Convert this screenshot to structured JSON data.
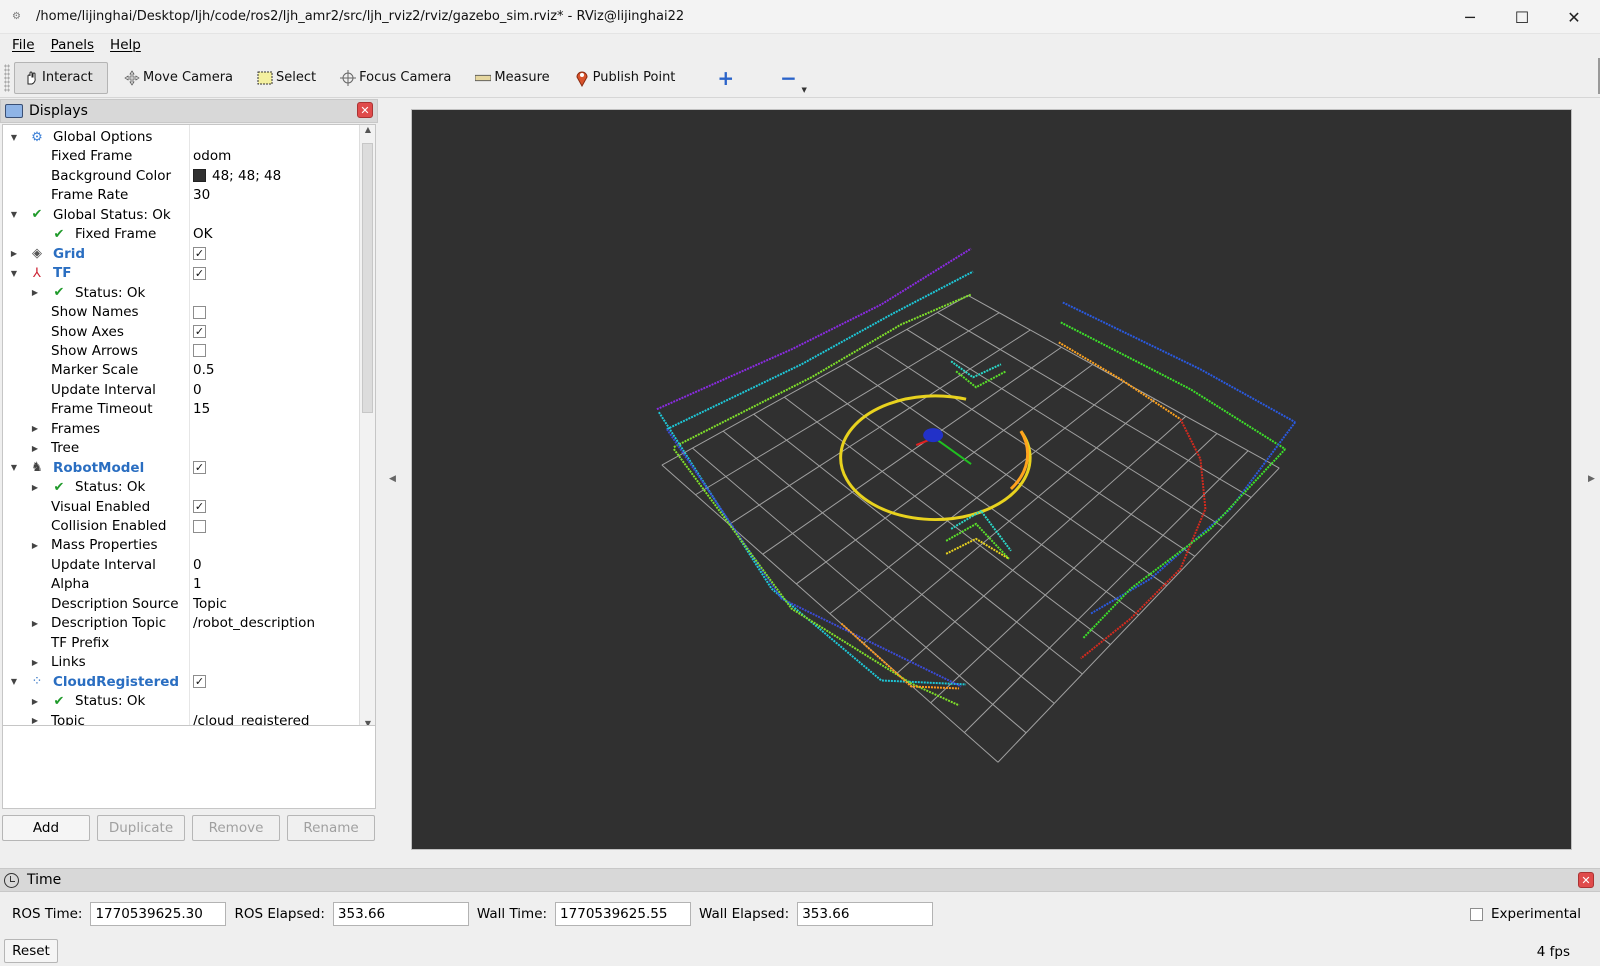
{
  "window": {
    "title": "/home/lijinghai/Desktop/ljh/code/ros2/ljh_amr2/src/ljh_rviz2/rviz/gazebo_sim.rviz* - RViz@lijinghai22",
    "controls": [
      "─",
      "☐",
      "✕"
    ]
  },
  "menu": [
    "File",
    "Panels",
    "Help"
  ],
  "toolbar": {
    "tools": [
      {
        "label": "Interact",
        "icon": "hand-icon",
        "active": true
      },
      {
        "label": "Move Camera",
        "icon": "move-camera-icon"
      },
      {
        "label": "Select",
        "icon": "select-icon"
      },
      {
        "label": "Focus Camera",
        "icon": "focus-camera-icon"
      },
      {
        "label": "Measure",
        "icon": "ruler-icon"
      },
      {
        "label": "Publish Point",
        "icon": "pin-icon"
      }
    ],
    "plus": "+",
    "minus": "−"
  },
  "displays": {
    "title": "Displays",
    "rows": [
      {
        "level": 0,
        "arrow": "▼",
        "icon": "gear",
        "label": "Global Options"
      },
      {
        "level": 1,
        "label": "Fixed Frame",
        "value": "odom"
      },
      {
        "level": 1,
        "label": "Background Color",
        "value": "48; 48; 48",
        "swatch": true
      },
      {
        "level": 1,
        "label": "Frame Rate",
        "value": "30"
      },
      {
        "level": 0,
        "arrow": "▼",
        "icon": "check",
        "label": "Global Status: Ok"
      },
      {
        "level": 1,
        "icon": "check",
        "label": "Fixed Frame",
        "value": "OK"
      },
      {
        "level": 0,
        "arrow": "▶",
        "icon": "grid",
        "label": "Grid",
        "bold": true,
        "checkbox": true
      },
      {
        "level": 0,
        "arrow": "▼",
        "icon": "axes",
        "label": "TF",
        "bold": true,
        "checkbox": true
      },
      {
        "level": 1,
        "arrow": "▶",
        "icon": "check",
        "label": "Status: Ok"
      },
      {
        "level": 1,
        "label": "Show Names",
        "checkbox": false
      },
      {
        "level": 1,
        "label": "Show Axes",
        "checkbox": true
      },
      {
        "level": 1,
        "label": "Show Arrows",
        "checkbox": false
      },
      {
        "level": 1,
        "label": "Marker Scale",
        "value": "0.5"
      },
      {
        "level": 1,
        "label": "Update Interval",
        "value": "0"
      },
      {
        "level": 1,
        "label": "Frame Timeout",
        "value": "15"
      },
      {
        "level": 1,
        "arrow": "▶",
        "label": "Frames"
      },
      {
        "level": 1,
        "arrow": "▶",
        "label": "Tree"
      },
      {
        "level": 0,
        "arrow": "▼",
        "icon": "robot",
        "label": "RobotModel",
        "bold": true,
        "checkbox": true
      },
      {
        "level": 1,
        "arrow": "▶",
        "icon": "check",
        "label": "Status: Ok"
      },
      {
        "level": 1,
        "label": "Visual Enabled",
        "checkbox": true
      },
      {
        "level": 1,
        "label": "Collision Enabled",
        "checkbox": false
      },
      {
        "level": 1,
        "arrow": "▶",
        "label": "Mass Properties"
      },
      {
        "level": 1,
        "label": "Update Interval",
        "value": "0"
      },
      {
        "level": 1,
        "label": "Alpha",
        "value": "1"
      },
      {
        "level": 1,
        "label": "Description Source",
        "value": "Topic"
      },
      {
        "level": 1,
        "arrow": "▶",
        "label": "Description Topic",
        "value": "/robot_description"
      },
      {
        "level": 1,
        "label": "TF Prefix"
      },
      {
        "level": 1,
        "arrow": "▶",
        "label": "Links"
      },
      {
        "level": 0,
        "arrow": "▼",
        "icon": "cloud",
        "label": "CloudRegistered",
        "bold": true,
        "checkbox": true
      },
      {
        "level": 1,
        "arrow": "▶",
        "icon": "check",
        "label": "Status: Ok"
      },
      {
        "level": 1,
        "arrow": "▶",
        "label": "Topic",
        "value": "/cloud_registered"
      }
    ],
    "buttons": [
      "Add",
      "Duplicate",
      "Remove",
      "Rename"
    ]
  },
  "viewport": {
    "background_color": "#303030",
    "grid_color": "#a0a0a0"
  },
  "time": {
    "title": "Time",
    "ros_time_label": "ROS Time:",
    "ros_time": "1770539625.30",
    "ros_elapsed_label": "ROS Elapsed:",
    "ros_elapsed": "353.66",
    "wall_time_label": "Wall Time:",
    "wall_time": "1770539625.55",
    "wall_elapsed_label": "Wall Elapsed:",
    "wall_elapsed": "353.66",
    "experimental_label": "Experimental",
    "reset_label": "Reset",
    "fps": "4 fps"
  }
}
